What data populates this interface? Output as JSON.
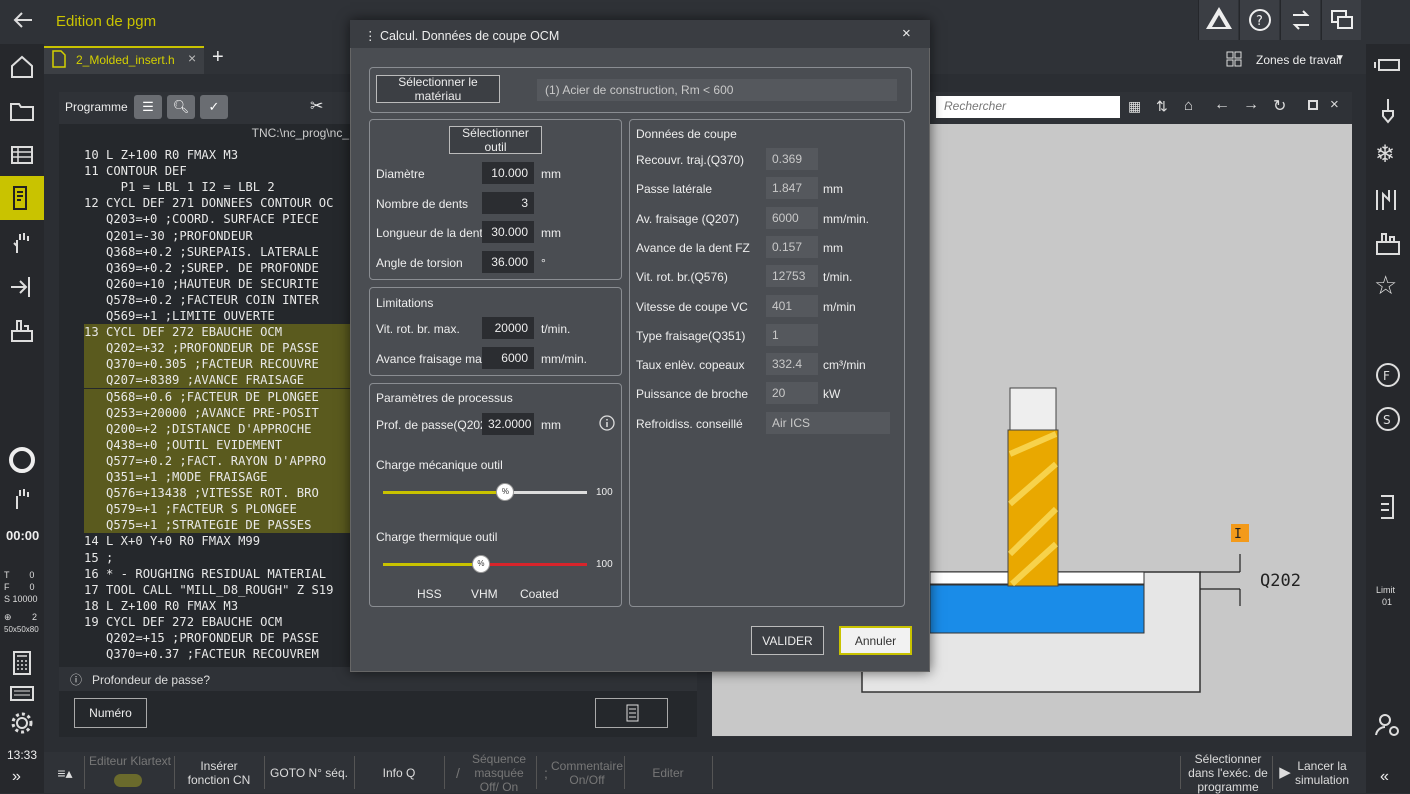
{
  "header": {
    "title": "Edition de pgm",
    "zones_label": "Zones de travail"
  },
  "tab": {
    "name": "2_Molded_insert.h"
  },
  "program_panel": {
    "label": "Programme",
    "path": "TNC:\\nc_prog\\nc_",
    "status_hint": "Profondeur de passe?",
    "number_button": "Numéro"
  },
  "left_sidebar": {
    "time": "00:00",
    "status_T": "T        0",
    "status_F": "F        0",
    "status_S": "S 10000",
    "status_num": "2",
    "status_dim": "50x50x80",
    "clock": "13:33"
  },
  "code_lines": [
    "10 L Z+100 R0 FMAX M3",
    "11 CONTOUR DEF ",
    "     P1 = LBL 1 I2 = LBL 2",
    "12 CYCL DEF 271 DONNEES CONTOUR OC",
    "   Q203=+0 ;COORD. SURFACE PIECE",
    "   Q201=-30 ;PROFONDEUR ",
    "   Q368=+0.2 ;SUREPAIS. LATERALE",
    "   Q369=+0.2 ;SUREP. DE PROFONDE",
    "   Q260=+10 ;HAUTEUR DE SECURITE",
    "   Q578=+0.2 ;FACTEUR COIN INTER",
    "   Q569=+1 ;LIMITE OUVERTE",
    "13 CYCL DEF 272 EBAUCHE OCM ",
    "   Q202=+32 ;PROFONDEUR DE PASSE",
    "   Q370=+0.305 ;FACTEUR RECOUVRE",
    "   Q207=+8389 ;AVANCE FRAISAGE ",
    "   Q568=+0.6 ;FACTEUR DE PLONGEE",
    "   Q253=+20000 ;AVANCE PRE-POSIT",
    "   Q200=+2 ;DISTANCE D'APPROCHE ",
    "   Q438=+0 ;OUTIL EVIDEMENT ",
    "   Q577=+0.2 ;FACT. RAYON D'APPRO",
    "   Q351=+1 ;MODE FRAISAGE ",
    "   Q576=+13438 ;VITESSE ROT. BRO",
    "   Q579=+1 ;FACTEUR S PLONGEE ",
    "   Q575=+1 ;STRATEGIE DE PASSES",
    "14 L X+0 Y+0 R0 FMAX M99",
    "15 ;",
    "16 * - ROUGHING RESIDUAL MATERIAL",
    "17 TOOL CALL \"MILL_D8_ROUGH\" Z S19",
    "18 L Z+100 R0 FMAX M3",
    "19 CYCL DEF 272 EBAUCHE OCM ",
    "   Q202=+15 ;PROFONDEUR DE PASSE",
    "   Q370=+0.37 ;FACTEUR RECOUVREM"
  ],
  "sim_panel": {
    "search_placeholder": "Rechercher",
    "q_label": "Q202",
    "limit_label": "Limit",
    "limit_value": "01"
  },
  "dialog": {
    "title": "Calcul. Données de coupe OCM",
    "select_material": "Sélectionner le matériau",
    "material_value": "(1) Acier de construction, Rm < 600",
    "select_tool": "Sélectionner outil",
    "tool_fields": [
      {
        "label": "Diamètre",
        "value": "10.000",
        "unit": "mm"
      },
      {
        "label": "Nombre de dents",
        "value": "3",
        "unit": ""
      },
      {
        "label": "Longueur de la dent",
        "value": "30.000",
        "unit": "mm"
      },
      {
        "label": "Angle de torsion",
        "value": "36.000",
        "unit": "°"
      }
    ],
    "limitations_title": "Limitations",
    "limit_fields": [
      {
        "label": "Vit. rot. br. max.",
        "value": "20000",
        "unit": "t/min."
      },
      {
        "label": "Avance fraisage max.",
        "value": "6000",
        "unit": "mm/min."
      }
    ],
    "process_title": "Paramètres de processus",
    "depth_label": "Prof. de passe(Q202)",
    "depth_value": "32.0000",
    "depth_unit": "mm",
    "mech_label": "Charge mécanique outil",
    "mech_max": "100",
    "mech_level": 0.6,
    "therm_label": "Charge thermique outil",
    "therm_max": "100",
    "therm_level": 0.48,
    "therm_hss": "HSS",
    "therm_vhm": "VHM",
    "therm_coated": "Coated",
    "slider_knob": "%",
    "cut_title": "Données de coupe",
    "cut_fields": [
      {
        "label": "Recouvr. traj.(Q370)",
        "value": "0.369",
        "unit": ""
      },
      {
        "label": "Passe latérale",
        "value": "1.847",
        "unit": "mm"
      },
      {
        "label": "Av. fraisage (Q207)",
        "value": "6000",
        "unit": "mm/min."
      },
      {
        "label": "Avance de la dent FZ",
        "value": "0.157",
        "unit": "mm"
      },
      {
        "label": "Vit. rot. br.(Q576)",
        "value": "12753",
        "unit": "t/min."
      },
      {
        "label": "Vitesse de coupe VC",
        "value": "401",
        "unit": "m/min"
      },
      {
        "label": "Type fraisage(Q351)",
        "value": "1",
        "unit": ""
      },
      {
        "label": "Taux enlèv. copeaux",
        "value": "332.4",
        "unit": "cm³/min"
      },
      {
        "label": "Puissance de broche",
        "value": "20",
        "unit": "kW"
      },
      {
        "label": "Refroidiss. conseillé",
        "value": "Air ICS",
        "unit": ""
      }
    ],
    "ok_button": "VALIDER",
    "cancel_button": "Annuler"
  },
  "bottom_bar": {
    "editor": "Editeur Klartext",
    "insert": "Insérer fonction CN",
    "goto": "GOTO N° séq.",
    "infoq": "Info Q",
    "masked": "Séquence masquée Off/ On",
    "comment": "Commentaire On/Off",
    "edit": "Editer",
    "select_run": "Sélectionner dans l'exéc. de programme",
    "simulate": "Lancer la simulation"
  },
  "colors": {
    "accent": "#c9c300",
    "highlight": "#5a5a1e",
    "dialog_bg": "#4a4d52"
  }
}
